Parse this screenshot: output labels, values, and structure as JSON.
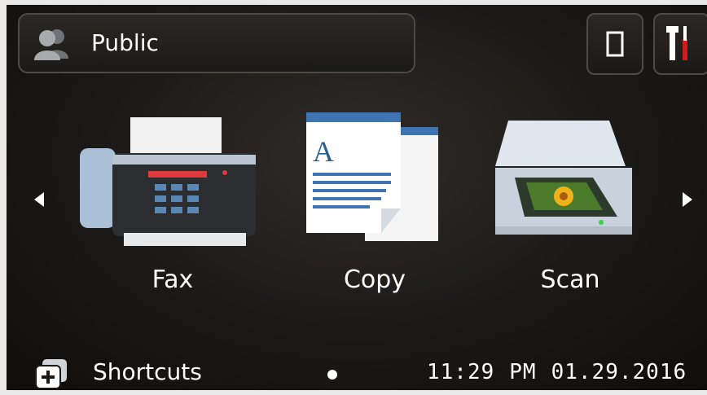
{
  "header": {
    "user_label": "Public",
    "icons": [
      "users-icon",
      "document-icon",
      "tools-icon"
    ]
  },
  "apps": [
    {
      "label": "Fax",
      "icon": "fax-icon"
    },
    {
      "label": "Copy",
      "icon": "copy-icon"
    },
    {
      "label": "Scan",
      "icon": "scanner-icon"
    }
  ],
  "nav": {
    "left": "arrow-left-icon",
    "right": "arrow-right-icon"
  },
  "footer": {
    "shortcuts_label": "Shortcuts",
    "time": "11:29",
    "ampm": "PM",
    "date": "01.29.2016"
  },
  "colors": {
    "background": "#1b1917",
    "text": "#ffffff",
    "tool_accent": "#d11a1a"
  }
}
